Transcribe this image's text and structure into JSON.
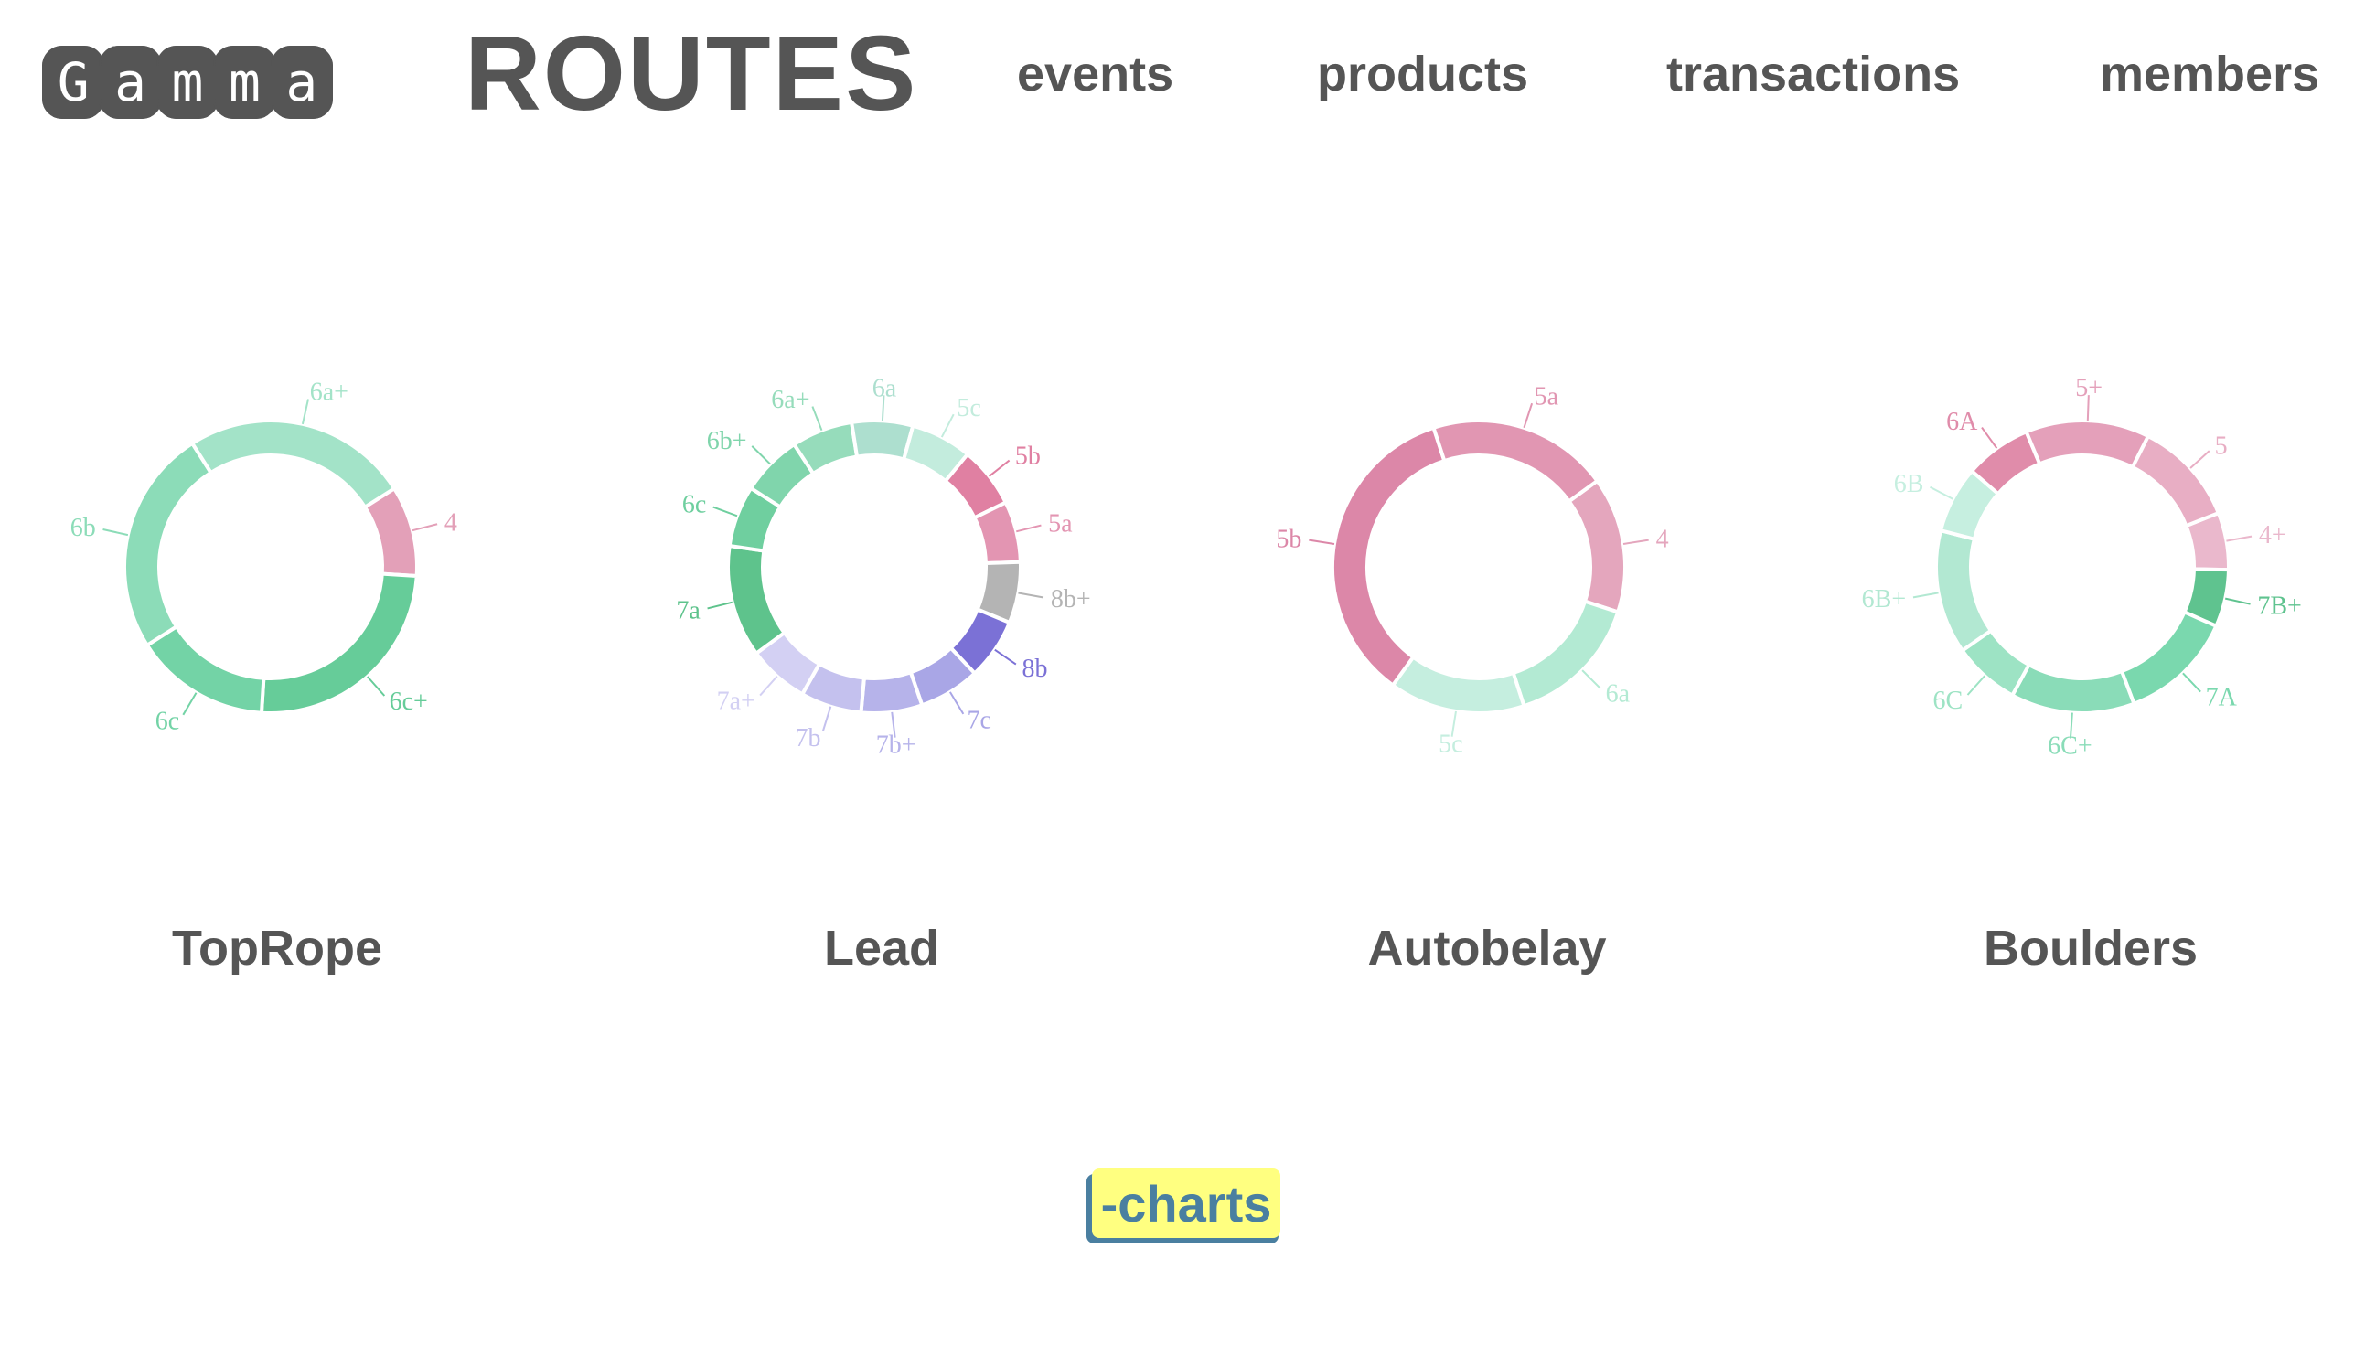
{
  "header": {
    "logo_letters": [
      "G",
      "a",
      "m",
      "m",
      "a"
    ],
    "title": "ROUTES",
    "nav": [
      "events",
      "products",
      "transactions",
      "members"
    ]
  },
  "footer": {
    "charts_button": "-charts"
  },
  "chart_data": [
    {
      "type": "donut",
      "title": "TopRope",
      "slices": [
        {
          "label": "4",
          "value": 10,
          "color": "#e3a0b8"
        },
        {
          "label": "6c+",
          "value": 25,
          "color": "#66cc99"
        },
        {
          "label": "6c",
          "value": 15,
          "color": "#73d3a6"
        },
        {
          "label": "6b",
          "value": 25,
          "color": "#8cdcb8"
        },
        {
          "label": "6a+",
          "value": 25,
          "color": "#a3e3c8"
        }
      ]
    },
    {
      "type": "donut",
      "title": "Lead",
      "slices": [
        {
          "label": "5b",
          "value": 6,
          "color": "#e080a2"
        },
        {
          "label": "5a",
          "value": 6,
          "color": "#e395b2"
        },
        {
          "label": "8b+",
          "value": 6,
          "color": "#b4b4b4"
        },
        {
          "label": "8b",
          "value": 6,
          "color": "#7b71d6"
        },
        {
          "label": "7c",
          "value": 6,
          "color": "#a9a6e6"
        },
        {
          "label": "7b+",
          "value": 6,
          "color": "#b6b3ea"
        },
        {
          "label": "7b",
          "value": 6,
          "color": "#c4c1ee"
        },
        {
          "label": "7a+",
          "value": 6,
          "color": "#d3d0f3"
        },
        {
          "label": "7a",
          "value": 11,
          "color": "#5ec38c"
        },
        {
          "label": "6c",
          "value": 6,
          "color": "#6fcf9f"
        },
        {
          "label": "6b+",
          "value": 6,
          "color": "#80d5ac"
        },
        {
          "label": "6a+",
          "value": 6,
          "color": "#96dcbb"
        },
        {
          "label": "6a",
          "value": 6,
          "color": "#addfcf"
        },
        {
          "label": "5c",
          "value": 6,
          "color": "#c3ecdd"
        }
      ]
    },
    {
      "type": "donut",
      "title": "Autobelay",
      "slices": [
        {
          "label": "4",
          "value": 15,
          "color": "#e4a6bd"
        },
        {
          "label": "6a",
          "value": 15,
          "color": "#b3ead3"
        },
        {
          "label": "5c",
          "value": 15,
          "color": "#c5eedf"
        },
        {
          "label": "5b",
          "value": 35,
          "color": "#dc87a8"
        },
        {
          "label": "5a",
          "value": 20,
          "color": "#e196b2"
        }
      ]
    },
    {
      "type": "donut",
      "title": "Boulders",
      "slices": [
        {
          "label": "4+",
          "value": 6,
          "color": "#eab8cc"
        },
        {
          "label": "7B+",
          "value": 6,
          "color": "#5fc38f"
        },
        {
          "label": "7A",
          "value": 12,
          "color": "#7ad8ae"
        },
        {
          "label": "6C+",
          "value": 13,
          "color": "#8adcb8"
        },
        {
          "label": "6C",
          "value": 7,
          "color": "#9de3c4"
        },
        {
          "label": "6B+",
          "value": 13,
          "color": "#b2e8d2"
        },
        {
          "label": "6B",
          "value": 7,
          "color": "#c6efe0"
        },
        {
          "label": "6A",
          "value": 7,
          "color": "#e08caa"
        },
        {
          "label": "5+",
          "value": 13,
          "color": "#e4a0ba"
        },
        {
          "label": "5",
          "value": 11,
          "color": "#e8aec4"
        }
      ]
    }
  ]
}
